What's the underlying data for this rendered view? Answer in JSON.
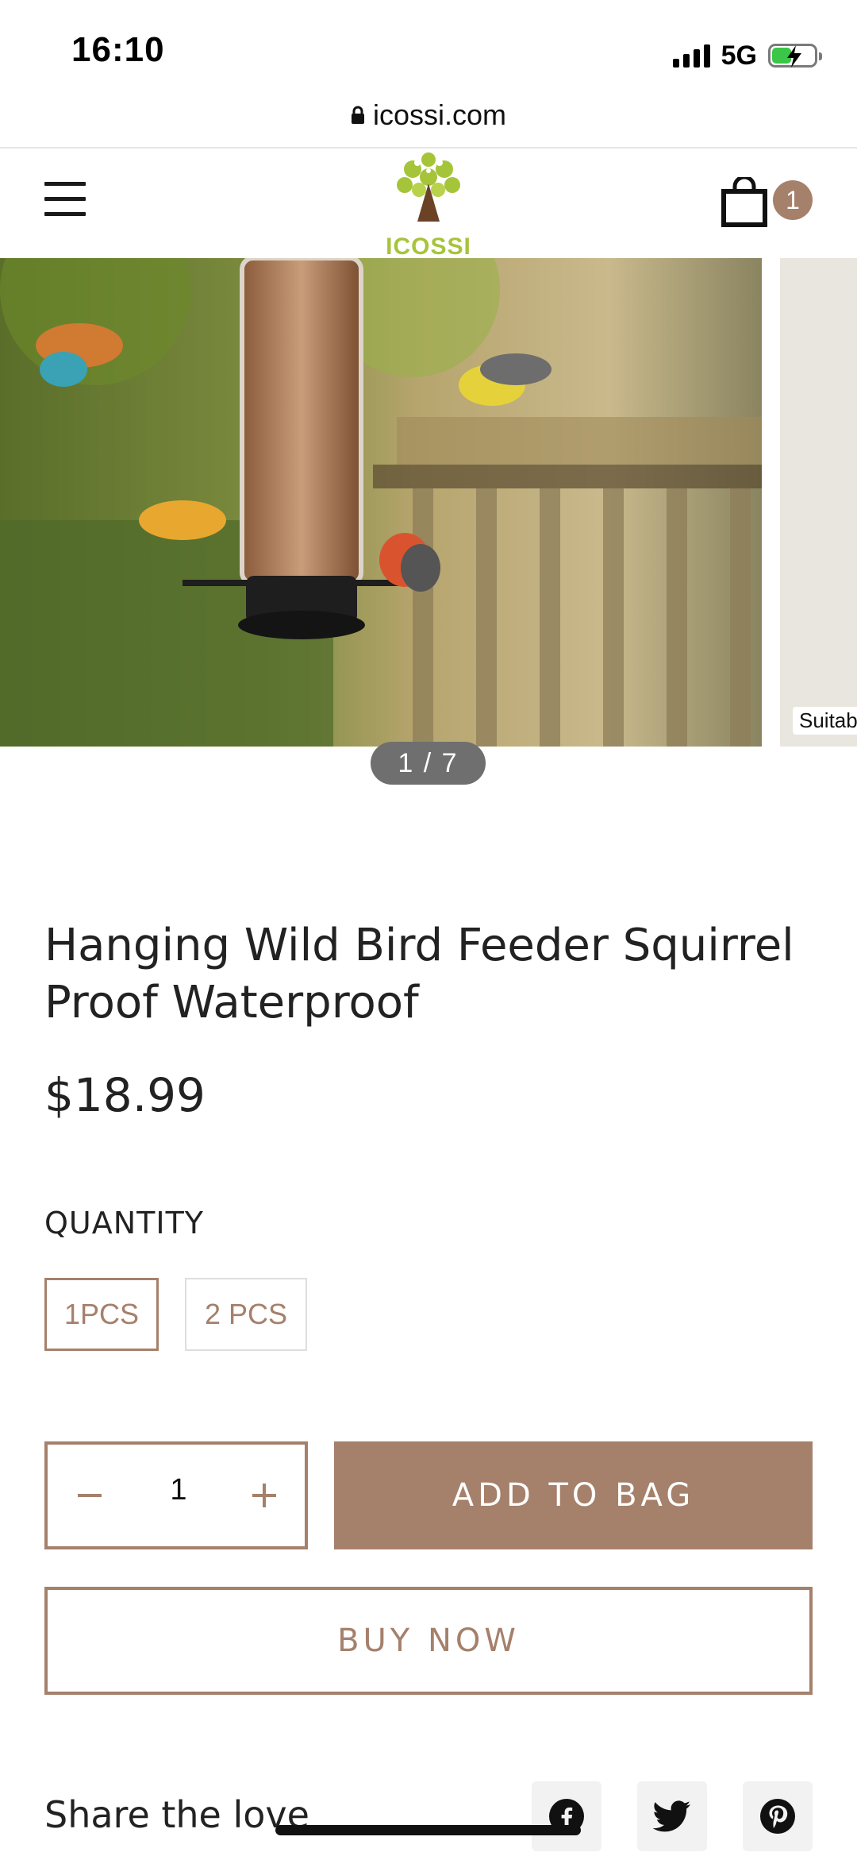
{
  "status_bar": {
    "time": "16:10",
    "network": "5G",
    "icons": [
      "signal-icon",
      "battery-charging-icon"
    ]
  },
  "browser": {
    "url": "icossi.com",
    "lock_icon": "lock-icon"
  },
  "header": {
    "menu_icon": "hamburger-menu-icon",
    "logo_text": "ICOSSI",
    "cart_icon": "shopping-bag-icon",
    "cart_count": "1",
    "colors": {
      "logo_green": "#a6c43a",
      "logo_brown": "#6b4226"
    }
  },
  "gallery": {
    "counter": "1 / 7",
    "next_slide_caption": "Suitable"
  },
  "product": {
    "title": "Hanging Wild Bird Feeder Squirrel Proof Waterproof",
    "price": "$18.99",
    "quantity_label": "QUANTITY",
    "variants": [
      {
        "label": "1PCS",
        "selected": true
      },
      {
        "label": "2 PCS",
        "selected": false
      }
    ],
    "quantity_value": "1",
    "add_to_bag_label": "ADD TO BAG",
    "buy_now_label": "BUY NOW"
  },
  "share": {
    "label": "Share the love",
    "icons": [
      "facebook-icon",
      "twitter-icon",
      "pinterest-icon"
    ]
  },
  "colors": {
    "accent": "#a5806b",
    "text": "#222222",
    "counter_bg": "#6f6f6f"
  }
}
